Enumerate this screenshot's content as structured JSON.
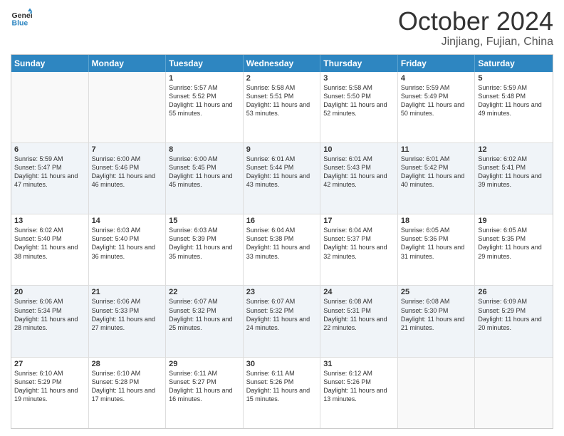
{
  "logo": {
    "line1": "General",
    "line2": "Blue"
  },
  "title": "October 2024",
  "location": "Jinjiang, Fujian, China",
  "weekdays": [
    "Sunday",
    "Monday",
    "Tuesday",
    "Wednesday",
    "Thursday",
    "Friday",
    "Saturday"
  ],
  "rows": [
    [
      {
        "day": "",
        "info": ""
      },
      {
        "day": "",
        "info": ""
      },
      {
        "day": "1",
        "info": "Sunrise: 5:57 AM\nSunset: 5:52 PM\nDaylight: 11 hours and 55 minutes."
      },
      {
        "day": "2",
        "info": "Sunrise: 5:58 AM\nSunset: 5:51 PM\nDaylight: 11 hours and 53 minutes."
      },
      {
        "day": "3",
        "info": "Sunrise: 5:58 AM\nSunset: 5:50 PM\nDaylight: 11 hours and 52 minutes."
      },
      {
        "day": "4",
        "info": "Sunrise: 5:59 AM\nSunset: 5:49 PM\nDaylight: 11 hours and 50 minutes."
      },
      {
        "day": "5",
        "info": "Sunrise: 5:59 AM\nSunset: 5:48 PM\nDaylight: 11 hours and 49 minutes."
      }
    ],
    [
      {
        "day": "6",
        "info": "Sunrise: 5:59 AM\nSunset: 5:47 PM\nDaylight: 11 hours and 47 minutes."
      },
      {
        "day": "7",
        "info": "Sunrise: 6:00 AM\nSunset: 5:46 PM\nDaylight: 11 hours and 46 minutes."
      },
      {
        "day": "8",
        "info": "Sunrise: 6:00 AM\nSunset: 5:45 PM\nDaylight: 11 hours and 45 minutes."
      },
      {
        "day": "9",
        "info": "Sunrise: 6:01 AM\nSunset: 5:44 PM\nDaylight: 11 hours and 43 minutes."
      },
      {
        "day": "10",
        "info": "Sunrise: 6:01 AM\nSunset: 5:43 PM\nDaylight: 11 hours and 42 minutes."
      },
      {
        "day": "11",
        "info": "Sunrise: 6:01 AM\nSunset: 5:42 PM\nDaylight: 11 hours and 40 minutes."
      },
      {
        "day": "12",
        "info": "Sunrise: 6:02 AM\nSunset: 5:41 PM\nDaylight: 11 hours and 39 minutes."
      }
    ],
    [
      {
        "day": "13",
        "info": "Sunrise: 6:02 AM\nSunset: 5:40 PM\nDaylight: 11 hours and 38 minutes."
      },
      {
        "day": "14",
        "info": "Sunrise: 6:03 AM\nSunset: 5:40 PM\nDaylight: 11 hours and 36 minutes."
      },
      {
        "day": "15",
        "info": "Sunrise: 6:03 AM\nSunset: 5:39 PM\nDaylight: 11 hours and 35 minutes."
      },
      {
        "day": "16",
        "info": "Sunrise: 6:04 AM\nSunset: 5:38 PM\nDaylight: 11 hours and 33 minutes."
      },
      {
        "day": "17",
        "info": "Sunrise: 6:04 AM\nSunset: 5:37 PM\nDaylight: 11 hours and 32 minutes."
      },
      {
        "day": "18",
        "info": "Sunrise: 6:05 AM\nSunset: 5:36 PM\nDaylight: 11 hours and 31 minutes."
      },
      {
        "day": "19",
        "info": "Sunrise: 6:05 AM\nSunset: 5:35 PM\nDaylight: 11 hours and 29 minutes."
      }
    ],
    [
      {
        "day": "20",
        "info": "Sunrise: 6:06 AM\nSunset: 5:34 PM\nDaylight: 11 hours and 28 minutes."
      },
      {
        "day": "21",
        "info": "Sunrise: 6:06 AM\nSunset: 5:33 PM\nDaylight: 11 hours and 27 minutes."
      },
      {
        "day": "22",
        "info": "Sunrise: 6:07 AM\nSunset: 5:32 PM\nDaylight: 11 hours and 25 minutes."
      },
      {
        "day": "23",
        "info": "Sunrise: 6:07 AM\nSunset: 5:32 PM\nDaylight: 11 hours and 24 minutes."
      },
      {
        "day": "24",
        "info": "Sunrise: 6:08 AM\nSunset: 5:31 PM\nDaylight: 11 hours and 22 minutes."
      },
      {
        "day": "25",
        "info": "Sunrise: 6:08 AM\nSunset: 5:30 PM\nDaylight: 11 hours and 21 minutes."
      },
      {
        "day": "26",
        "info": "Sunrise: 6:09 AM\nSunset: 5:29 PM\nDaylight: 11 hours and 20 minutes."
      }
    ],
    [
      {
        "day": "27",
        "info": "Sunrise: 6:10 AM\nSunset: 5:29 PM\nDaylight: 11 hours and 19 minutes."
      },
      {
        "day": "28",
        "info": "Sunrise: 6:10 AM\nSunset: 5:28 PM\nDaylight: 11 hours and 17 minutes."
      },
      {
        "day": "29",
        "info": "Sunrise: 6:11 AM\nSunset: 5:27 PM\nDaylight: 11 hours and 16 minutes."
      },
      {
        "day": "30",
        "info": "Sunrise: 6:11 AM\nSunset: 5:26 PM\nDaylight: 11 hours and 15 minutes."
      },
      {
        "day": "31",
        "info": "Sunrise: 6:12 AM\nSunset: 5:26 PM\nDaylight: 11 hours and 13 minutes."
      },
      {
        "day": "",
        "info": ""
      },
      {
        "day": "",
        "info": ""
      }
    ]
  ]
}
